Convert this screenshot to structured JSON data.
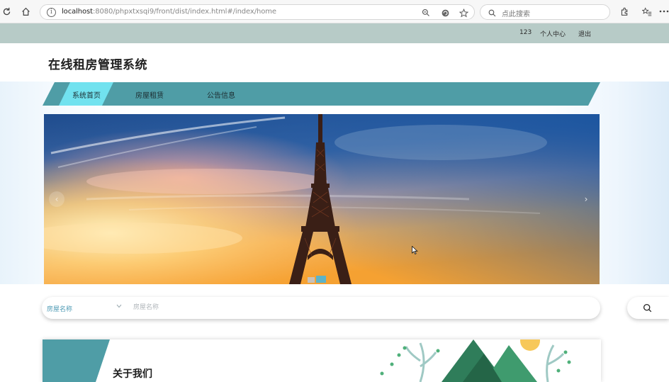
{
  "browser": {
    "url_host": "localhost",
    "url_rest": ":8080/phpxtxsqi9/front/dist/index.html#/index/home",
    "search_placeholder": "点此搜索"
  },
  "user_bar": {
    "username": "123",
    "profile_label": "个人中心",
    "logout_label": "退出"
  },
  "header": {
    "title": "在线租房管理系统"
  },
  "nav": {
    "items": [
      {
        "label": "系统首页",
        "active": true
      },
      {
        "label": "房屋租赁",
        "active": false
      },
      {
        "label": "公告信息",
        "active": false
      }
    ]
  },
  "carousel": {
    "prev_label": "‹",
    "next_label": "›"
  },
  "search": {
    "select_value": "房屋名称",
    "input_placeholder": "房屋名称"
  },
  "about": {
    "title": "关于我们"
  },
  "colors": {
    "accent": "#4f9da6",
    "active_tab": "#71e2ef",
    "user_bar": "#b7cbc7"
  }
}
